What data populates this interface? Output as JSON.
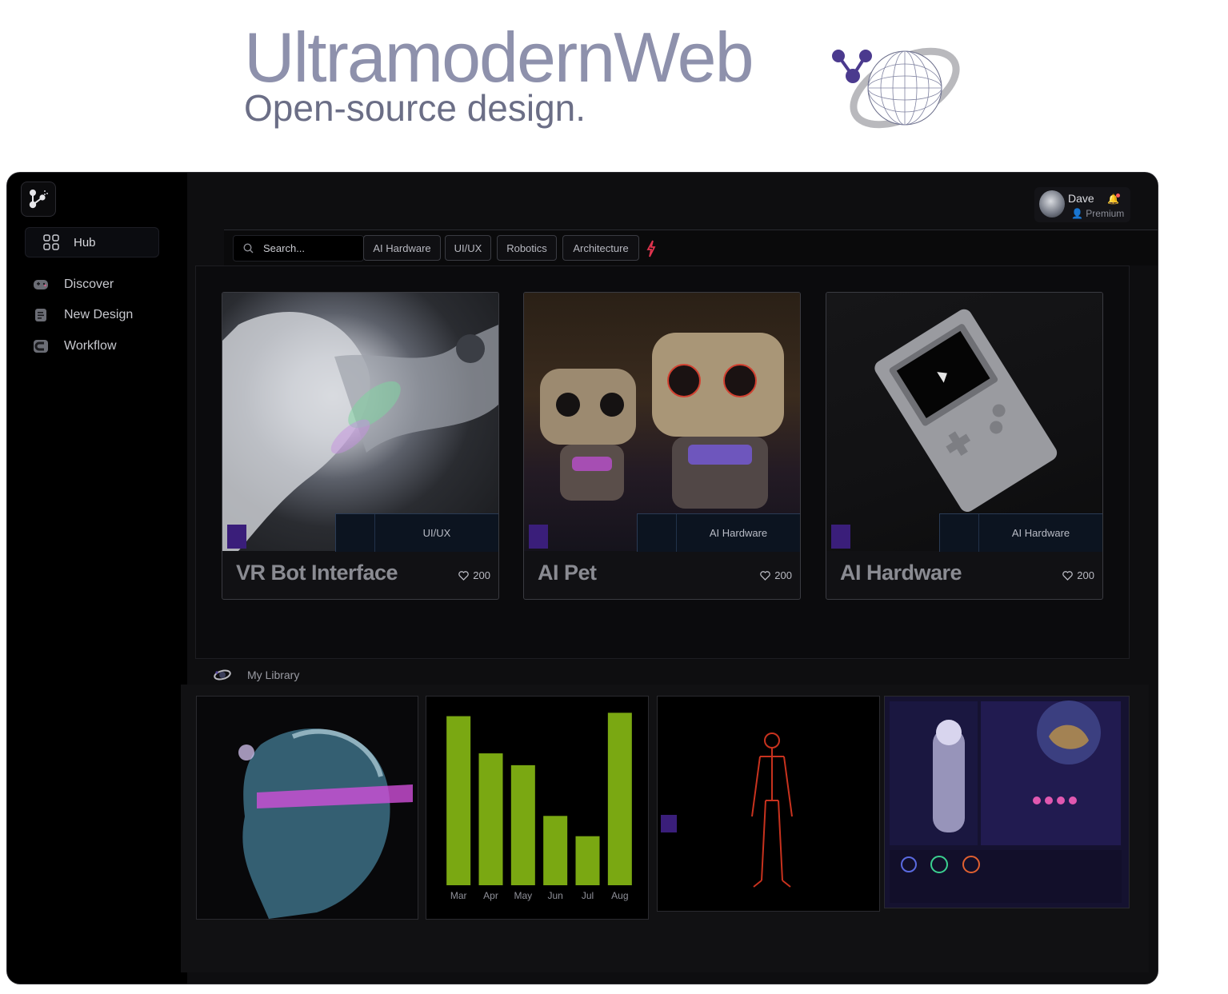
{
  "hero": {
    "title": "UltramodernWeb",
    "subtitle": "Open-source design."
  },
  "sidebar": {
    "hub_label": "Hub",
    "items": [
      {
        "label": "Discover",
        "icon": "gamepad-icon"
      },
      {
        "label": "New Design",
        "icon": "document-icon"
      },
      {
        "label": "Workflow",
        "icon": "workflow-icon"
      }
    ]
  },
  "user": {
    "name": "Dave",
    "role": "Premium"
  },
  "search": {
    "placeholder": "Search..."
  },
  "filters": [
    "AI Hardware",
    "UI/UX",
    "Robotics",
    "Architecture"
  ],
  "cards": [
    {
      "title": "VR Bot Interface",
      "tag": "UI/UX",
      "likes": "200"
    },
    {
      "title": "AI Pet",
      "tag": "AI Hardware",
      "likes": "200"
    },
    {
      "title": "AI Hardware",
      "tag": "AI Hardware",
      "likes": "200"
    }
  ],
  "library": {
    "title": "My Library"
  },
  "chart_data": {
    "type": "bar",
    "categories": [
      "Mar",
      "Apr",
      "May",
      "Jun",
      "Jul",
      "Aug"
    ],
    "values": [
      100,
      78,
      71,
      41,
      29,
      102
    ],
    "ylim": [
      0,
      105
    ],
    "color": "#7aa812",
    "grid": false
  },
  "colors": {
    "accent_purple": "#3a1e7a",
    "bar_green": "#7aa812",
    "notification": "#ff5a5a"
  }
}
